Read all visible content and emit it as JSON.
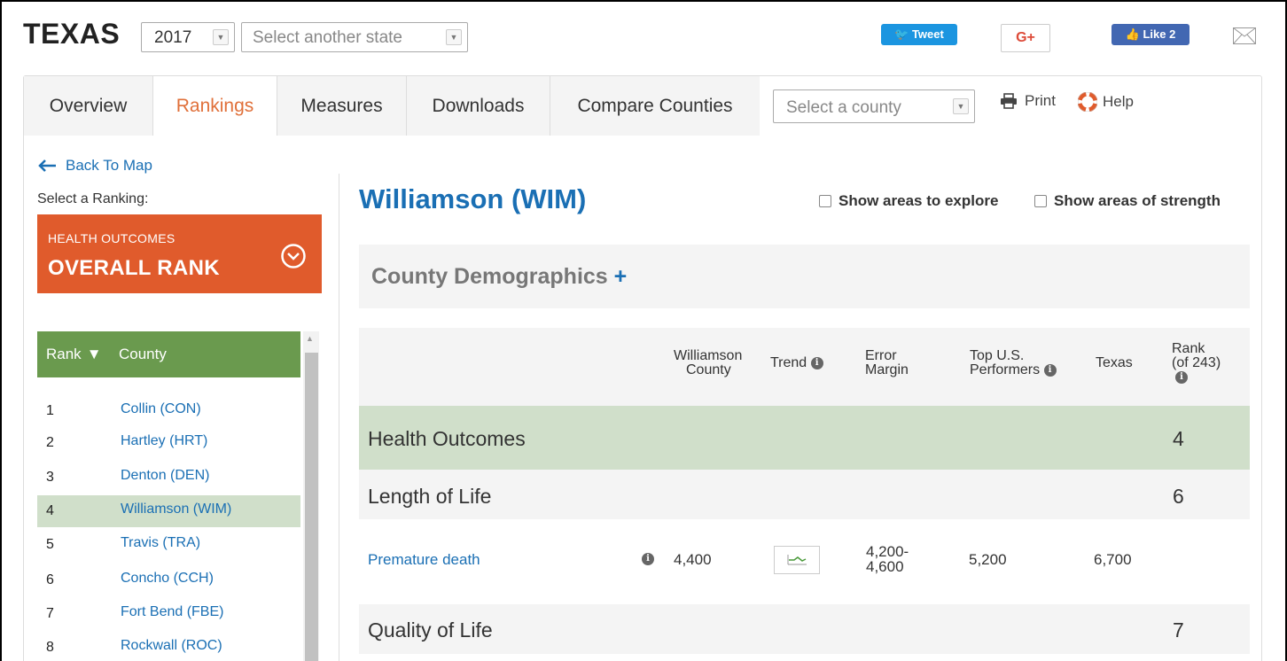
{
  "header": {
    "state": "TEXAS",
    "year": "2017",
    "state_select_placeholder": "Select another state",
    "tweet_label": "Tweet",
    "gplus_label": "G+",
    "like_label": "Like 2"
  },
  "tabs": [
    {
      "label": "Overview",
      "active": false
    },
    {
      "label": "Rankings",
      "active": true
    },
    {
      "label": "Measures",
      "active": false
    },
    {
      "label": "Downloads",
      "active": false
    },
    {
      "label": "Compare Counties",
      "active": false
    }
  ],
  "toolbar": {
    "county_select_placeholder": "Select a county",
    "print_label": "Print",
    "help_label": "Help"
  },
  "sidebar": {
    "back_label": "Back To Map",
    "select_ranking_label": "Select a Ranking:",
    "ranking_category": "HEALTH OUTCOMES",
    "ranking_name": "OVERALL RANK",
    "table_header_rank": "Rank",
    "table_header_county": "County",
    "rows": [
      {
        "rank": "1",
        "county": "Collin (CON)"
      },
      {
        "rank": "2",
        "county": "Hartley (HRT)"
      },
      {
        "rank": "3",
        "county": "Denton (DEN)"
      },
      {
        "rank": "4",
        "county": "Williamson (WIM)",
        "selected": true
      },
      {
        "rank": "5",
        "county": "Travis (TRA)"
      },
      {
        "rank": "6",
        "county": "Concho (CCH)"
      },
      {
        "rank": "7",
        "county": "Fort Bend (FBE)"
      },
      {
        "rank": "8",
        "county": "Rockwall (ROC)"
      }
    ]
  },
  "main": {
    "county_title": "Williamson (WIM)",
    "show_explore_label": "Show areas to explore",
    "show_strength_label": "Show areas of strength",
    "demographics_label": "County Demographics",
    "demographics_plus": "+",
    "columns": {
      "county_line1": "Williamson",
      "county_line2": "County",
      "trend": "Trend",
      "error_line1": "Error",
      "error_line2": "Margin",
      "top_line1": "Top U.S.",
      "top_line2": "Performers",
      "state": "Texas",
      "rank_line1": "Rank",
      "rank_line2": "(of 243)"
    },
    "sections": {
      "health_outcomes": {
        "label": "Health Outcomes",
        "rank": "4"
      },
      "length_of_life": {
        "label": "Length of Life",
        "rank": "6"
      },
      "quality_of_life": {
        "label": "Quality of Life",
        "rank": "7"
      }
    },
    "measure": {
      "name": "Premature death",
      "value": "4,400",
      "error_line1": "4,200-",
      "error_line2": "4,600",
      "top_performers": "5,200",
      "state_value": "6,700"
    }
  },
  "colors": {
    "accent_orange": "#e05b2c",
    "link_blue": "#1a6fb4",
    "table_green": "#6a9a4e",
    "selected_row": "#d0dfca"
  }
}
